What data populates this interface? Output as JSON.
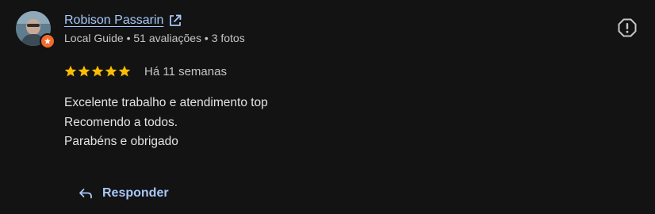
{
  "reviewer": {
    "name": "Robison Passarin",
    "meta": "Local Guide • 51 avaliações • 3 fotos",
    "avatar_icon": "profile-photo",
    "badge_icon": "local-guide-star-badge"
  },
  "rating": {
    "stars": 5,
    "max_stars": 5,
    "time": "Há 11 semanas"
  },
  "review": {
    "lines": [
      "Excelente trabalho e atendimento top",
      "Recomendo a todos.",
      "Parabéns e obrigado"
    ]
  },
  "actions": {
    "reply_label": "Responder",
    "report_icon": "report-alert-icon",
    "external_icon": "open-in-new-icon"
  },
  "colors": {
    "background": "#131313",
    "link": "#a8c7fa",
    "star": "#fbbc04",
    "badge": "#f26b2a",
    "text": "#e3e3e3",
    "muted": "#c4c7c5"
  }
}
